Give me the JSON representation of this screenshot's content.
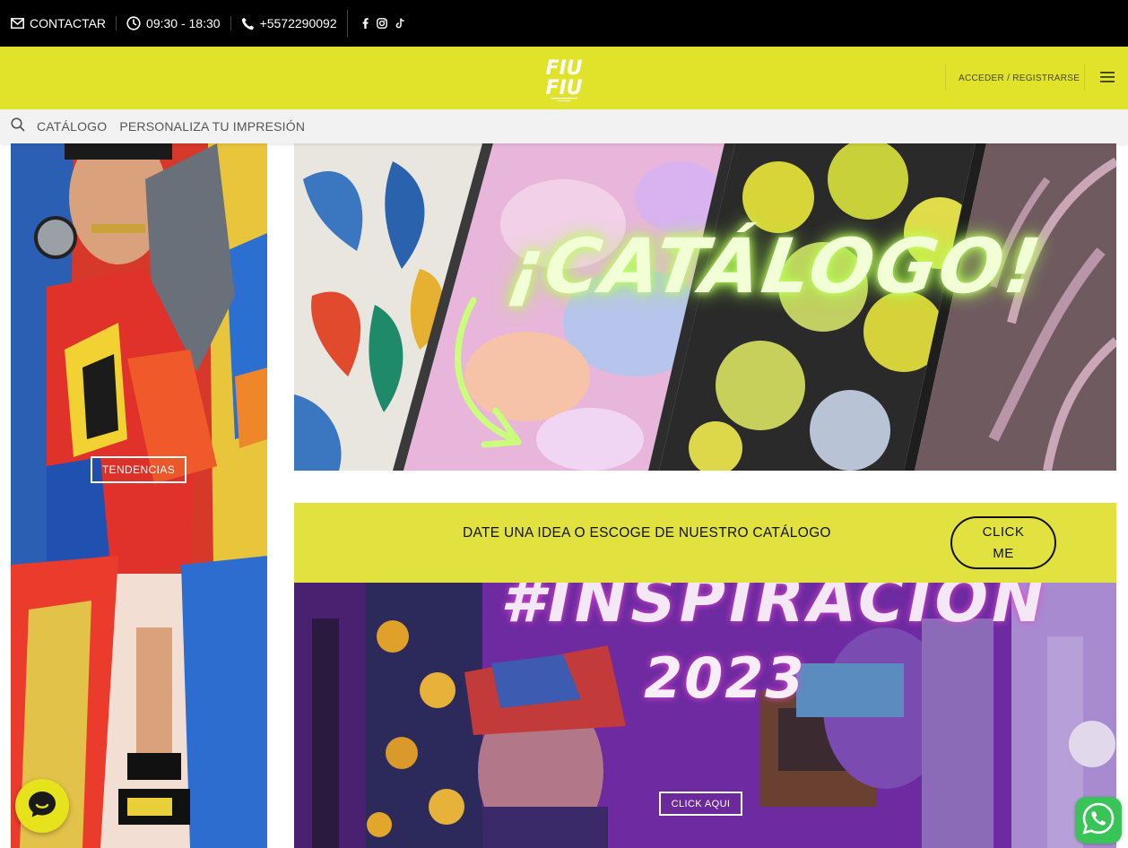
{
  "topbar": {
    "contact_label": "CONTACTAR",
    "hours": "09:30 - 18:30",
    "phone": "+5572290092",
    "contact_icon": "envelope-icon",
    "hours_icon": "clock-icon",
    "phone_icon": "phone-icon",
    "social_icons": [
      "facebook-icon",
      "instagram-icon",
      "tiktok-icon"
    ]
  },
  "header": {
    "logo_text": "FIU FIU",
    "account_link": "ACCEDER / REGISTRARSE",
    "menu_icon": "hamburger-menu-icon",
    "background": "#e1e22a"
  },
  "nav": {
    "search_icon": "search-icon",
    "items": [
      {
        "label": "CATÁLOGO"
      },
      {
        "label": "PERSONALIZA TU IMPRESIÓN"
      }
    ]
  },
  "left_banner": {
    "button_label": "TENDENCIAS"
  },
  "catalog_banner": {
    "title": "¡CATÁLOGO!"
  },
  "idea_bar": {
    "text": "DATE UNA IDEA O ESCOGE DE NUESTRO CATÁLOGO",
    "button_label": "CLICK ME",
    "background": "#e1e23f"
  },
  "inspiration_banner": {
    "title": "#INSPIRACIÓN",
    "year": "2023",
    "button_label": "CLICK AQUI"
  },
  "widgets": {
    "chat_icon": "chat-bubble-icon",
    "whatsapp_icon": "whatsapp-icon"
  }
}
